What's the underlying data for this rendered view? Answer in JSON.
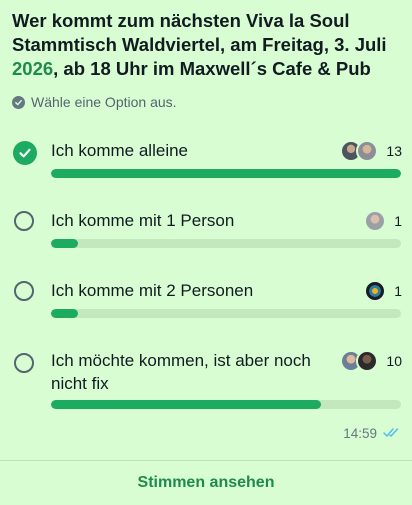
{
  "poll": {
    "question_part1": "Wer kommt zum nächsten Viva la Soul Stammtisch Waldviertel, am Freitag, 3. Juli ",
    "question_year": "2026",
    "question_part2": ", ab 18 Uhr im Maxwell´s Cafe & Pub",
    "hint": "Wähle eine Option aus.",
    "options": [
      {
        "label": "Ich komme alleine",
        "count": "13",
        "progress": 1.0,
        "selected": true,
        "avatars": [
          "avatar-man-glasses",
          "avatar-man-beard"
        ]
      },
      {
        "label": "Ich komme mit 1 Person",
        "count": "1",
        "progress": 0.077,
        "selected": false,
        "avatars": [
          "avatar-man-grey"
        ]
      },
      {
        "label": "Ich komme mit 2 Personen",
        "count": "1",
        "progress": 0.077,
        "selected": false,
        "avatars": [
          "avatar-colorful"
        ]
      },
      {
        "label": "Ich möchte kommen, ist aber noch nicht fix",
        "count": "10",
        "progress": 0.77,
        "selected": false,
        "avatars": [
          "avatar-woman",
          "avatar-man-dark"
        ]
      }
    ],
    "timestamp": "14:59",
    "read_status": "double-check-icon",
    "view_votes_label": "Stimmen ansehen"
  },
  "colors": {
    "bubble_bg": "#d9fdd3",
    "accent": "#1daa61",
    "accent_text": "#1f8a4c",
    "track": "#c4e8bd",
    "read_tick": "#53bdeb"
  }
}
